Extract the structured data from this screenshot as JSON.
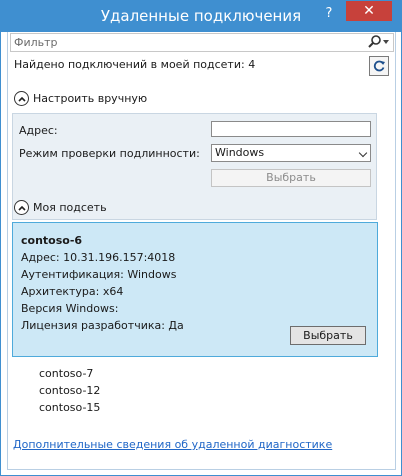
{
  "window": {
    "title": "Удаленные подключения",
    "help_label": "?",
    "close_label": "✕"
  },
  "filter": {
    "placeholder": "Фильтр"
  },
  "status": {
    "found_text": "Найдено подключений в моей подсети: 4"
  },
  "manual": {
    "toggle_label": "Настроить вручную",
    "address_label": "Адрес:",
    "address_value": "",
    "auth_label": "Режим проверки подлинности:",
    "auth_value": "Windows",
    "select_label": "Выбрать"
  },
  "subnet": {
    "toggle_label": "Моя подсеть",
    "selected": {
      "name": "contoso-6",
      "address": "Адрес: 10.31.196.157:4018",
      "auth": "Аутентификация: Windows",
      "arch": "Архитектура: x64",
      "version": "Версия Windows:",
      "license": "Лицензия разработчика: Да",
      "select_label": "Выбрать"
    },
    "others": [
      "contoso-7",
      "contoso-12",
      "contoso-15"
    ]
  },
  "footer": {
    "link_text": "Дополнительные сведения об удаленной диагностике"
  },
  "icons": {
    "search": "search-icon",
    "refresh": "refresh-icon",
    "chevron": "chevron-up-icon",
    "dropdown": "chevron-down-icon"
  },
  "colors": {
    "titlebar": "#3f8fd0",
    "close": "#c7413b",
    "selected_bg": "#cde8f6",
    "selected_border": "#4eaadb",
    "link": "#2167c7"
  }
}
